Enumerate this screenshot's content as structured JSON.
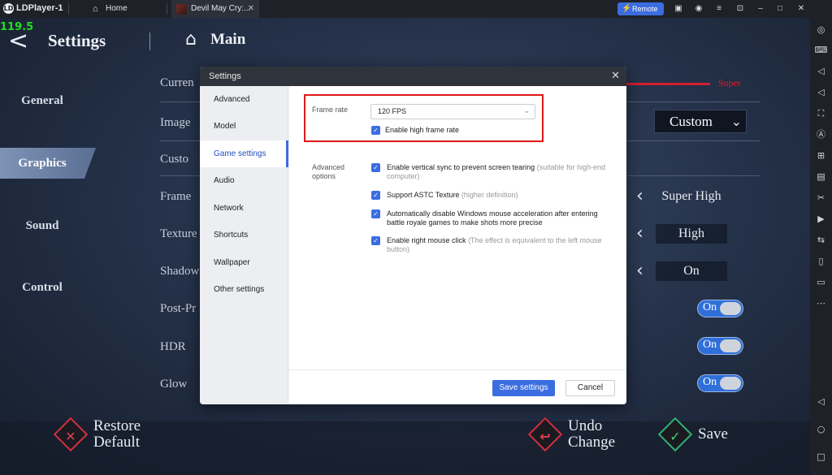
{
  "titlebar": {
    "app_name": "LDPlayer-1",
    "logo_letters": "LD",
    "home_tab": "Home",
    "game_tab": "Devil May Cry:...",
    "remote": "Remote"
  },
  "game": {
    "fps_counter": "119.5",
    "title": "Settings",
    "main_label": "Main",
    "sidebar": [
      {
        "label": "General"
      },
      {
        "label": "Graphics"
      },
      {
        "label": "Sound"
      },
      {
        "label": "Control"
      }
    ],
    "rows": [
      {
        "label": "Curren"
      },
      {
        "label": "Image"
      },
      {
        "label": "Custo"
      },
      {
        "label": "Frame"
      },
      {
        "label": "Texture"
      },
      {
        "label": "Shadow"
      },
      {
        "label": "Post-Pr"
      },
      {
        "label": "HDR"
      },
      {
        "label": "Glow"
      }
    ],
    "quality_slider_end": "Super",
    "image_preset": "Custom",
    "frame_value": "Super High",
    "texture_value": "High",
    "shadow_value": "On",
    "toggle_label": "On",
    "restore_line1": "Restore",
    "restore_line2": "Default",
    "undo_line1": "Undo",
    "undo_line2": "Change",
    "save": "Save"
  },
  "dialog": {
    "title": "Settings",
    "nav": [
      {
        "label": "Advanced"
      },
      {
        "label": "Model"
      },
      {
        "label": "Game settings"
      },
      {
        "label": "Audio"
      },
      {
        "label": "Network"
      },
      {
        "label": "Shortcuts"
      },
      {
        "label": "Wallpaper"
      },
      {
        "label": "Other settings"
      }
    ],
    "frame_rate_label": "Frame rate",
    "frame_rate_value": "120 FPS",
    "high_frame_rate": "Enable high frame rate",
    "advanced_label_1": "Advanced",
    "advanced_label_2": "options",
    "options": [
      {
        "text": "Enable vertical sync to prevent screen tearing",
        "hint": "(suitable for high-end computer)"
      },
      {
        "text": "Support ASTC Texture",
        "hint": "(higher definition)"
      },
      {
        "text": "Automatically disable Windows mouse acceleration after entering battle royale games to make shots more precise",
        "hint": ""
      },
      {
        "text": "Enable right mouse click",
        "hint": "(The effect is equivalent to the left mouse button)"
      }
    ],
    "save_button": "Save settings",
    "cancel_button": "Cancel"
  },
  "colors": {
    "accent": "#3b6de0",
    "highlight": "#e01818",
    "slider": "#d02030"
  },
  "icons": [
    "home-icon",
    "remote-icon",
    "gamepad-icon",
    "user-icon",
    "menu-icon",
    "minimize-icon",
    "maximize-icon",
    "close-icon",
    "back-arrow-icon",
    "chevron-left-icon",
    "chevron-down-icon",
    "cross-icon",
    "undo-icon",
    "check-icon",
    "checkbox-icon"
  ]
}
